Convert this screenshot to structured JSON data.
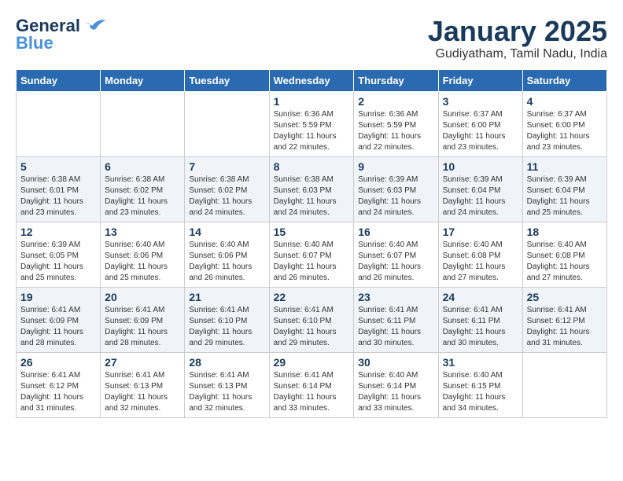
{
  "logo": {
    "line1": "General",
    "line2": "Blue"
  },
  "title": "January 2025",
  "subtitle": "Gudiyatham, Tamil Nadu, India",
  "days_of_week": [
    "Sunday",
    "Monday",
    "Tuesday",
    "Wednesday",
    "Thursday",
    "Friday",
    "Saturday"
  ],
  "weeks": [
    [
      {
        "day": "",
        "info": ""
      },
      {
        "day": "",
        "info": ""
      },
      {
        "day": "",
        "info": ""
      },
      {
        "day": "1",
        "info": "Sunrise: 6:36 AM\nSunset: 5:59 PM\nDaylight: 11 hours\nand 22 minutes."
      },
      {
        "day": "2",
        "info": "Sunrise: 6:36 AM\nSunset: 5:59 PM\nDaylight: 11 hours\nand 22 minutes."
      },
      {
        "day": "3",
        "info": "Sunrise: 6:37 AM\nSunset: 6:00 PM\nDaylight: 11 hours\nand 23 minutes."
      },
      {
        "day": "4",
        "info": "Sunrise: 6:37 AM\nSunset: 6:00 PM\nDaylight: 11 hours\nand 23 minutes."
      }
    ],
    [
      {
        "day": "5",
        "info": "Sunrise: 6:38 AM\nSunset: 6:01 PM\nDaylight: 11 hours\nand 23 minutes."
      },
      {
        "day": "6",
        "info": "Sunrise: 6:38 AM\nSunset: 6:02 PM\nDaylight: 11 hours\nand 23 minutes."
      },
      {
        "day": "7",
        "info": "Sunrise: 6:38 AM\nSunset: 6:02 PM\nDaylight: 11 hours\nand 24 minutes."
      },
      {
        "day": "8",
        "info": "Sunrise: 6:38 AM\nSunset: 6:03 PM\nDaylight: 11 hours\nand 24 minutes."
      },
      {
        "day": "9",
        "info": "Sunrise: 6:39 AM\nSunset: 6:03 PM\nDaylight: 11 hours\nand 24 minutes."
      },
      {
        "day": "10",
        "info": "Sunrise: 6:39 AM\nSunset: 6:04 PM\nDaylight: 11 hours\nand 24 minutes."
      },
      {
        "day": "11",
        "info": "Sunrise: 6:39 AM\nSunset: 6:04 PM\nDaylight: 11 hours\nand 25 minutes."
      }
    ],
    [
      {
        "day": "12",
        "info": "Sunrise: 6:39 AM\nSunset: 6:05 PM\nDaylight: 11 hours\nand 25 minutes."
      },
      {
        "day": "13",
        "info": "Sunrise: 6:40 AM\nSunset: 6:06 PM\nDaylight: 11 hours\nand 25 minutes."
      },
      {
        "day": "14",
        "info": "Sunrise: 6:40 AM\nSunset: 6:06 PM\nDaylight: 11 hours\nand 26 minutes."
      },
      {
        "day": "15",
        "info": "Sunrise: 6:40 AM\nSunset: 6:07 PM\nDaylight: 11 hours\nand 26 minutes."
      },
      {
        "day": "16",
        "info": "Sunrise: 6:40 AM\nSunset: 6:07 PM\nDaylight: 11 hours\nand 26 minutes."
      },
      {
        "day": "17",
        "info": "Sunrise: 6:40 AM\nSunset: 6:08 PM\nDaylight: 11 hours\nand 27 minutes."
      },
      {
        "day": "18",
        "info": "Sunrise: 6:40 AM\nSunset: 6:08 PM\nDaylight: 11 hours\nand 27 minutes."
      }
    ],
    [
      {
        "day": "19",
        "info": "Sunrise: 6:41 AM\nSunset: 6:09 PM\nDaylight: 11 hours\nand 28 minutes."
      },
      {
        "day": "20",
        "info": "Sunrise: 6:41 AM\nSunset: 6:09 PM\nDaylight: 11 hours\nand 28 minutes."
      },
      {
        "day": "21",
        "info": "Sunrise: 6:41 AM\nSunset: 6:10 PM\nDaylight: 11 hours\nand 29 minutes."
      },
      {
        "day": "22",
        "info": "Sunrise: 6:41 AM\nSunset: 6:10 PM\nDaylight: 11 hours\nand 29 minutes."
      },
      {
        "day": "23",
        "info": "Sunrise: 6:41 AM\nSunset: 6:11 PM\nDaylight: 11 hours\nand 30 minutes."
      },
      {
        "day": "24",
        "info": "Sunrise: 6:41 AM\nSunset: 6:11 PM\nDaylight: 11 hours\nand 30 minutes."
      },
      {
        "day": "25",
        "info": "Sunrise: 6:41 AM\nSunset: 6:12 PM\nDaylight: 11 hours\nand 31 minutes."
      }
    ],
    [
      {
        "day": "26",
        "info": "Sunrise: 6:41 AM\nSunset: 6:12 PM\nDaylight: 11 hours\nand 31 minutes."
      },
      {
        "day": "27",
        "info": "Sunrise: 6:41 AM\nSunset: 6:13 PM\nDaylight: 11 hours\nand 32 minutes."
      },
      {
        "day": "28",
        "info": "Sunrise: 6:41 AM\nSunset: 6:13 PM\nDaylight: 11 hours\nand 32 minutes."
      },
      {
        "day": "29",
        "info": "Sunrise: 6:41 AM\nSunset: 6:14 PM\nDaylight: 11 hours\nand 33 minutes."
      },
      {
        "day": "30",
        "info": "Sunrise: 6:40 AM\nSunset: 6:14 PM\nDaylight: 11 hours\nand 33 minutes."
      },
      {
        "day": "31",
        "info": "Sunrise: 6:40 AM\nSunset: 6:15 PM\nDaylight: 11 hours\nand 34 minutes."
      },
      {
        "day": "",
        "info": ""
      }
    ]
  ]
}
